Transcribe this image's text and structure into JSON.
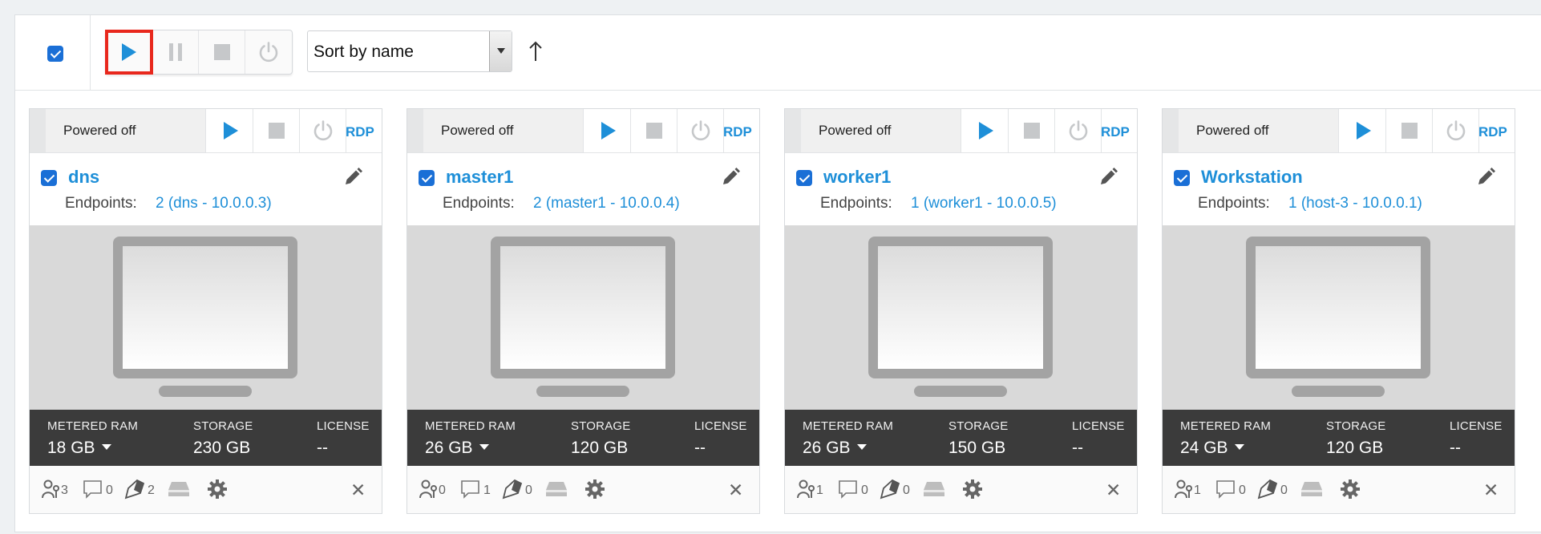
{
  "toolbar": {
    "select_all_checked": true,
    "sort_value": "Sort by name",
    "sort_direction_icon": "arrow-up-icon",
    "buttons": [
      {
        "name": "start-all-button",
        "icon": "play-icon",
        "state": "active"
      },
      {
        "name": "pause-all-button",
        "icon": "pause-icon",
        "state": "disabled"
      },
      {
        "name": "stop-all-button",
        "icon": "stop-icon",
        "state": "disabled"
      },
      {
        "name": "power-off-all-button",
        "icon": "power-icon",
        "state": "disabled"
      }
    ]
  },
  "colors": {
    "accent": "#1e8fd8",
    "checkbox": "#1a6fd6",
    "highlight": "#e8281d",
    "stats_bg": "#3b3b3b",
    "disabled_icon": "#c6c8ca"
  },
  "labels": {
    "rdp": "RDP",
    "endpoints": "Endpoints:",
    "metered_ram": "METERED RAM",
    "storage": "STORAGE",
    "license": "LICENSE",
    "close": "✕"
  },
  "cards": [
    {
      "status": "Powered off",
      "name": "dns",
      "endpoints": "2 (dns - 10.0.0.3)",
      "ram": "18 GB",
      "storage": "230 GB",
      "license": "--",
      "counts": {
        "users": "3",
        "comments": "0",
        "tags": "2"
      }
    },
    {
      "status": "Powered off",
      "name": "master1",
      "endpoints": "2 (master1 - 10.0.0.4)",
      "ram": "26 GB",
      "storage": "120 GB",
      "license": "--",
      "counts": {
        "users": "0",
        "comments": "1",
        "tags": "0"
      }
    },
    {
      "status": "Powered off",
      "name": "worker1",
      "endpoints": "1 (worker1 - 10.0.0.5)",
      "ram": "26 GB",
      "storage": "150 GB",
      "license": "--",
      "counts": {
        "users": "1",
        "comments": "0",
        "tags": "0"
      }
    },
    {
      "status": "Powered off",
      "name": "Workstation",
      "endpoints": "1 (host-3 - 10.0.0.1)",
      "ram": "24 GB",
      "storage": "120 GB",
      "license": "--",
      "counts": {
        "users": "1",
        "comments": "0",
        "tags": "0"
      }
    }
  ]
}
